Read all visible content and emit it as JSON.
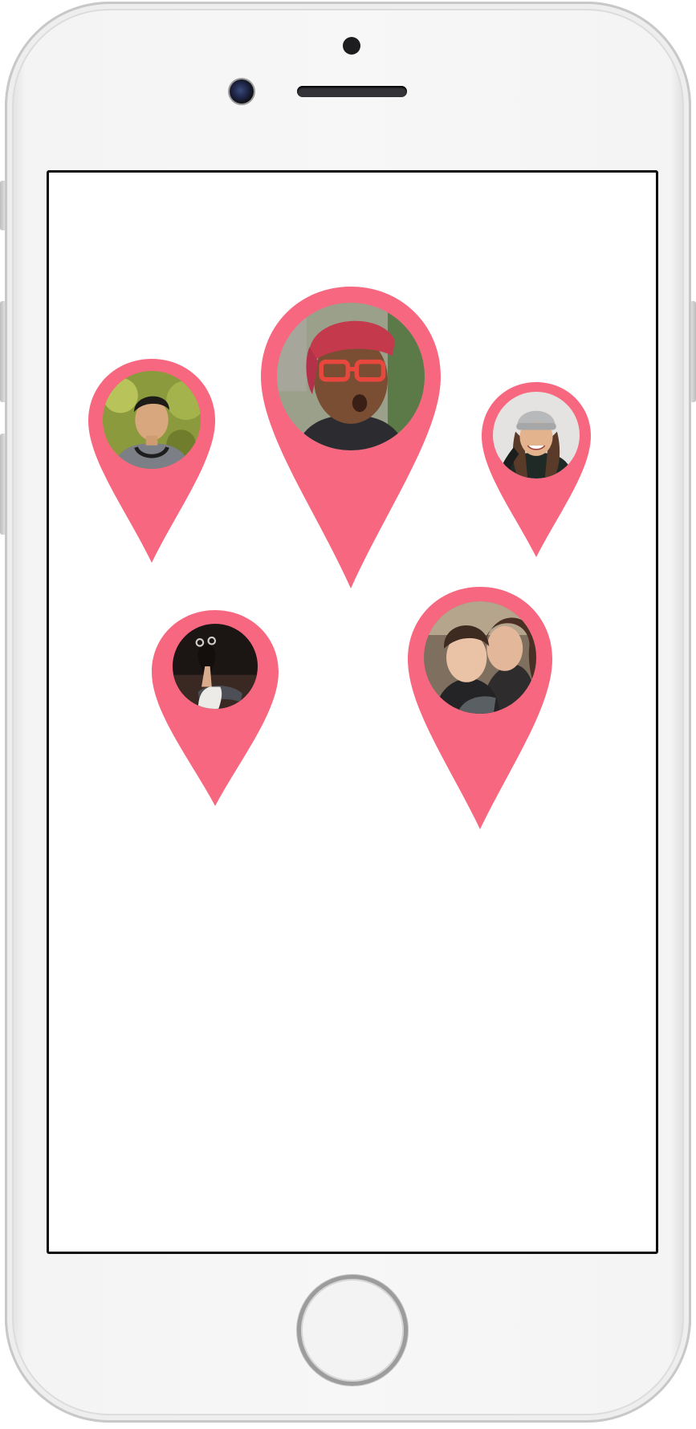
{
  "screen": {
    "background": "#ffffff",
    "content": "map-pins"
  },
  "pin_color": "#f7677f",
  "pins": [
    {
      "name": "pin-person-1",
      "avatar": "man-with-headphones-avatar",
      "size": "medium"
    },
    {
      "name": "pin-person-2",
      "avatar": "man-with-red-glasses-avatar",
      "size": "large"
    },
    {
      "name": "pin-person-3",
      "avatar": "woman-in-beanie-avatar",
      "size": "small"
    },
    {
      "name": "pin-person-4",
      "avatar": "woman-sitting-avatar",
      "size": "medium"
    },
    {
      "name": "pin-person-5",
      "avatar": "couple-selfie-avatar",
      "size": "large"
    }
  ],
  "device": {
    "model": "phone",
    "color": "silver"
  }
}
